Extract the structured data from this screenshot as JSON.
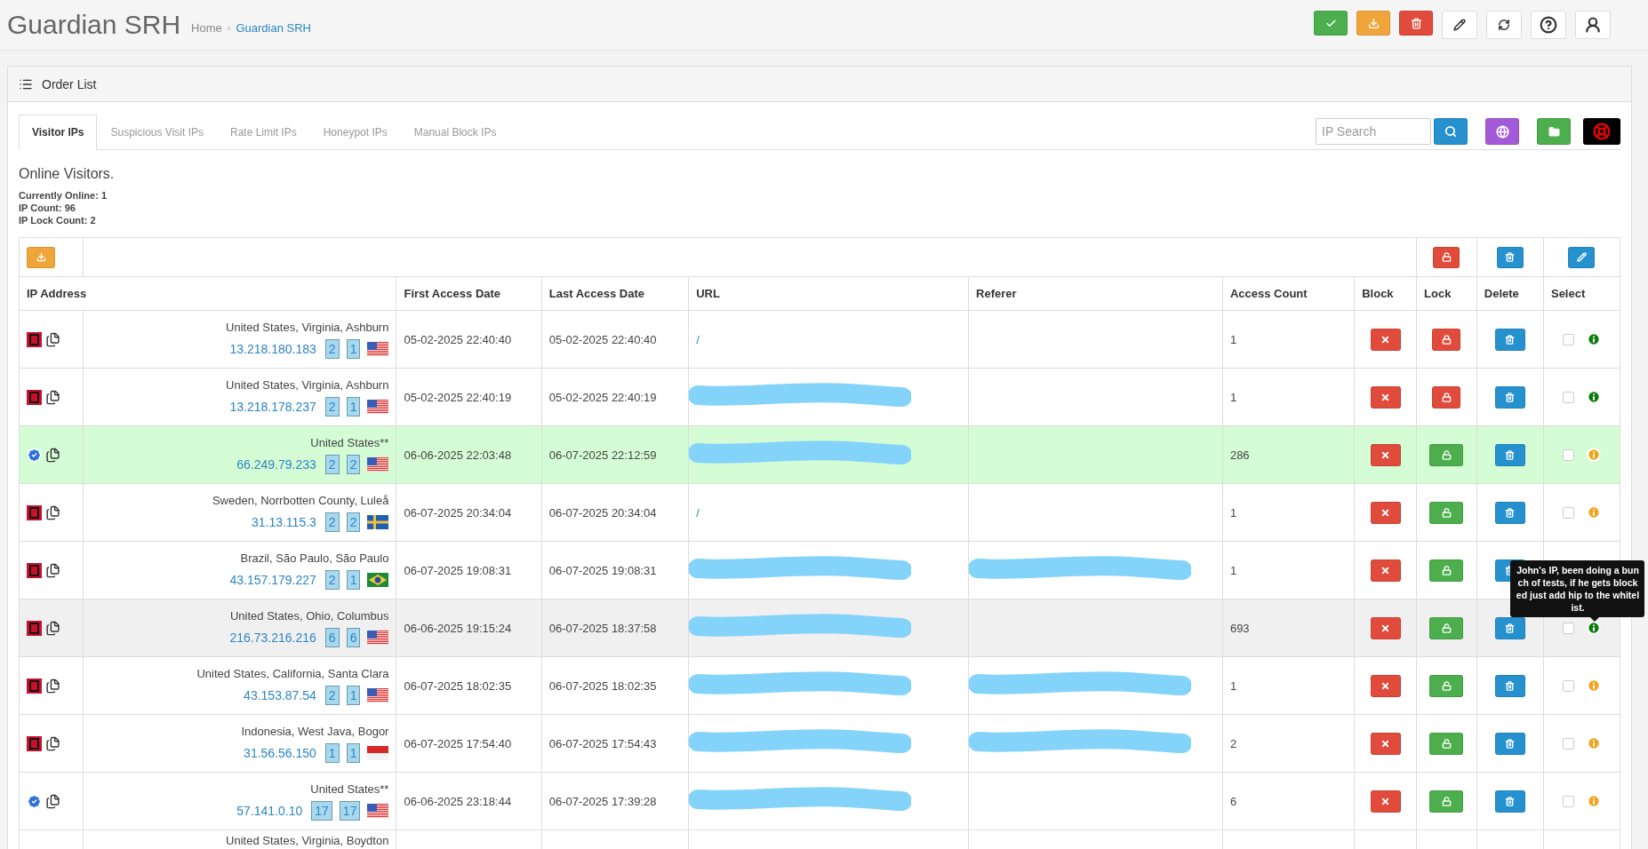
{
  "header": {
    "title": "Guardian SRH",
    "separator": "›",
    "breadcrumb": [
      {
        "label": "Home",
        "link": false
      },
      {
        "label": "Guardian SRH",
        "link": true
      }
    ]
  },
  "panel": {
    "title": "Order List"
  },
  "tabs": [
    {
      "label": "Visitor IPs",
      "selected": true
    },
    {
      "label": "Suspicious Visit IPs",
      "selected": false
    },
    {
      "label": "Rate Limit IPs",
      "selected": false
    },
    {
      "label": "Honeypot IPs",
      "selected": false
    },
    {
      "label": "Manual Block IPs",
      "selected": false
    }
  ],
  "search": {
    "placeholder": "IP Search"
  },
  "summary": {
    "heading": "Online Visitors.",
    "lines": [
      "Currently Online: 1",
      "IP Count: 96",
      "IP Lock Count: 2"
    ]
  },
  "table": {
    "columns": [
      "IP Address",
      "First Access Date",
      "Last Access Date",
      "URL",
      "Referer",
      "Access Count",
      "Block",
      "Lock",
      "Delete",
      "Select"
    ],
    "rows": [
      {
        "verified": false,
        "highlighted": false,
        "hovered": false,
        "location": "United States, Virginia, Ashburn",
        "ip": "13.218.180.183",
        "badges": [
          "2",
          "1"
        ],
        "flag": {
          "kind": "us"
        },
        "first": "05-02-2025 22:40:40",
        "last": "05-02-2025 22:40:40",
        "url": {
          "text": "/"
        },
        "referer": {},
        "count": "1",
        "locked": true,
        "checked": false,
        "info": {
          "color": "#0b7d0b"
        }
      },
      {
        "verified": false,
        "highlighted": false,
        "hovered": false,
        "location": "United States, Virginia, Ashburn",
        "ip": "13.218.178.237",
        "badges": [
          "2",
          "1"
        ],
        "flag": {
          "kind": "us"
        },
        "first": "05-02-2025 22:40:19",
        "last": "05-02-2025 22:40:19",
        "url": {
          "redacted": true
        },
        "referer": {},
        "count": "1",
        "locked": true,
        "checked": false,
        "info": {
          "color": "#0b7d0b"
        }
      },
      {
        "verified": true,
        "highlighted": true,
        "hovered": false,
        "location": "United States**",
        "ip": "66.249.79.233",
        "badges": [
          "2",
          "2"
        ],
        "flag": {
          "kind": "us"
        },
        "first": "06-06-2025 22:03:48",
        "last": "06-07-2025 22:12:59",
        "url": {
          "redacted": true
        },
        "referer": {},
        "count": "286",
        "locked": false,
        "checked": false,
        "info": {
          "color": "#f3a31c"
        }
      },
      {
        "verified": false,
        "highlighted": false,
        "hovered": false,
        "location": "Sweden, Norrbotten County, Luleå",
        "ip": "31.13.115.3",
        "badges": [
          "2",
          "2"
        ],
        "flag": {
          "kind": "se"
        },
        "first": "06-07-2025 20:34:04",
        "last": "06-07-2025 20:34:04",
        "url": {
          "text": "/"
        },
        "referer": {},
        "count": "1",
        "locked": false,
        "checked": false,
        "info": {
          "color": "#f3a31c"
        }
      },
      {
        "verified": false,
        "highlighted": false,
        "hovered": false,
        "location": "Brazil, São Paulo, São Paulo",
        "ip": "43.157.179.227",
        "badges": [
          "2",
          "1"
        ],
        "flag": {
          "kind": "br"
        },
        "first": "06-07-2025 19:08:31",
        "last": "06-07-2025 19:08:31",
        "url": {
          "redacted": true
        },
        "referer": {
          "redacted": true
        },
        "count": "1",
        "locked": false
      },
      {
        "verified": false,
        "highlighted": false,
        "hovered": true,
        "location": "United States, Ohio, Columbus",
        "ip": "216.73.216.216",
        "badges": [
          "6",
          "6"
        ],
        "flag": {
          "kind": "us"
        },
        "first": "06-06-2025 19:15:24",
        "last": "06-07-2025 18:37:58",
        "url": {
          "redacted": true
        },
        "referer": {},
        "count": "693",
        "locked": false,
        "checked": false,
        "info": {
          "color": "#0b7d0b",
          "tooltip": "John's IP, been doing a bunch of tests, if he gets blocked just add hip to the whitelist."
        }
      },
      {
        "verified": false,
        "highlighted": false,
        "hovered": false,
        "location": "United States, California, Santa Clara",
        "ip": "43.153.87.54",
        "badges": [
          "2",
          "1"
        ],
        "flag": {
          "kind": "us"
        },
        "first": "06-07-2025 18:02:35",
        "last": "06-07-2025 18:02:35",
        "url": {
          "redacted": true
        },
        "referer": {
          "redacted": true
        },
        "count": "1",
        "locked": false,
        "checked": false,
        "info": {
          "color": "#f3a31c"
        }
      },
      {
        "verified": false,
        "highlighted": false,
        "hovered": false,
        "location": "Indonesia, West Java, Bogor",
        "ip": "31.56.56.150",
        "badges": [
          "1",
          "1"
        ],
        "flag": {
          "kind": "id"
        },
        "first": "06-07-2025 17:54:40",
        "last": "06-07-2025 17:54:43",
        "url": {
          "redacted": true
        },
        "referer": {
          "redacted": true
        },
        "count": "2",
        "locked": false,
        "checked": false,
        "info": {
          "color": "#f3a31c"
        }
      },
      {
        "verified": true,
        "highlighted": false,
        "hovered": false,
        "location": "United States**",
        "ip": "57.141.0.10",
        "badges": [
          "17",
          "17"
        ],
        "flag": {
          "kind": "us"
        },
        "first": "06-06-2025 23:18:44",
        "last": "06-07-2025 17:39:28",
        "url": {
          "redacted": true
        },
        "referer": {},
        "count": "6",
        "locked": false,
        "checked": false,
        "info": {
          "color": "#f3a31c"
        }
      },
      {
        "location": "United States, Virginia, Boydton"
      }
    ]
  }
}
